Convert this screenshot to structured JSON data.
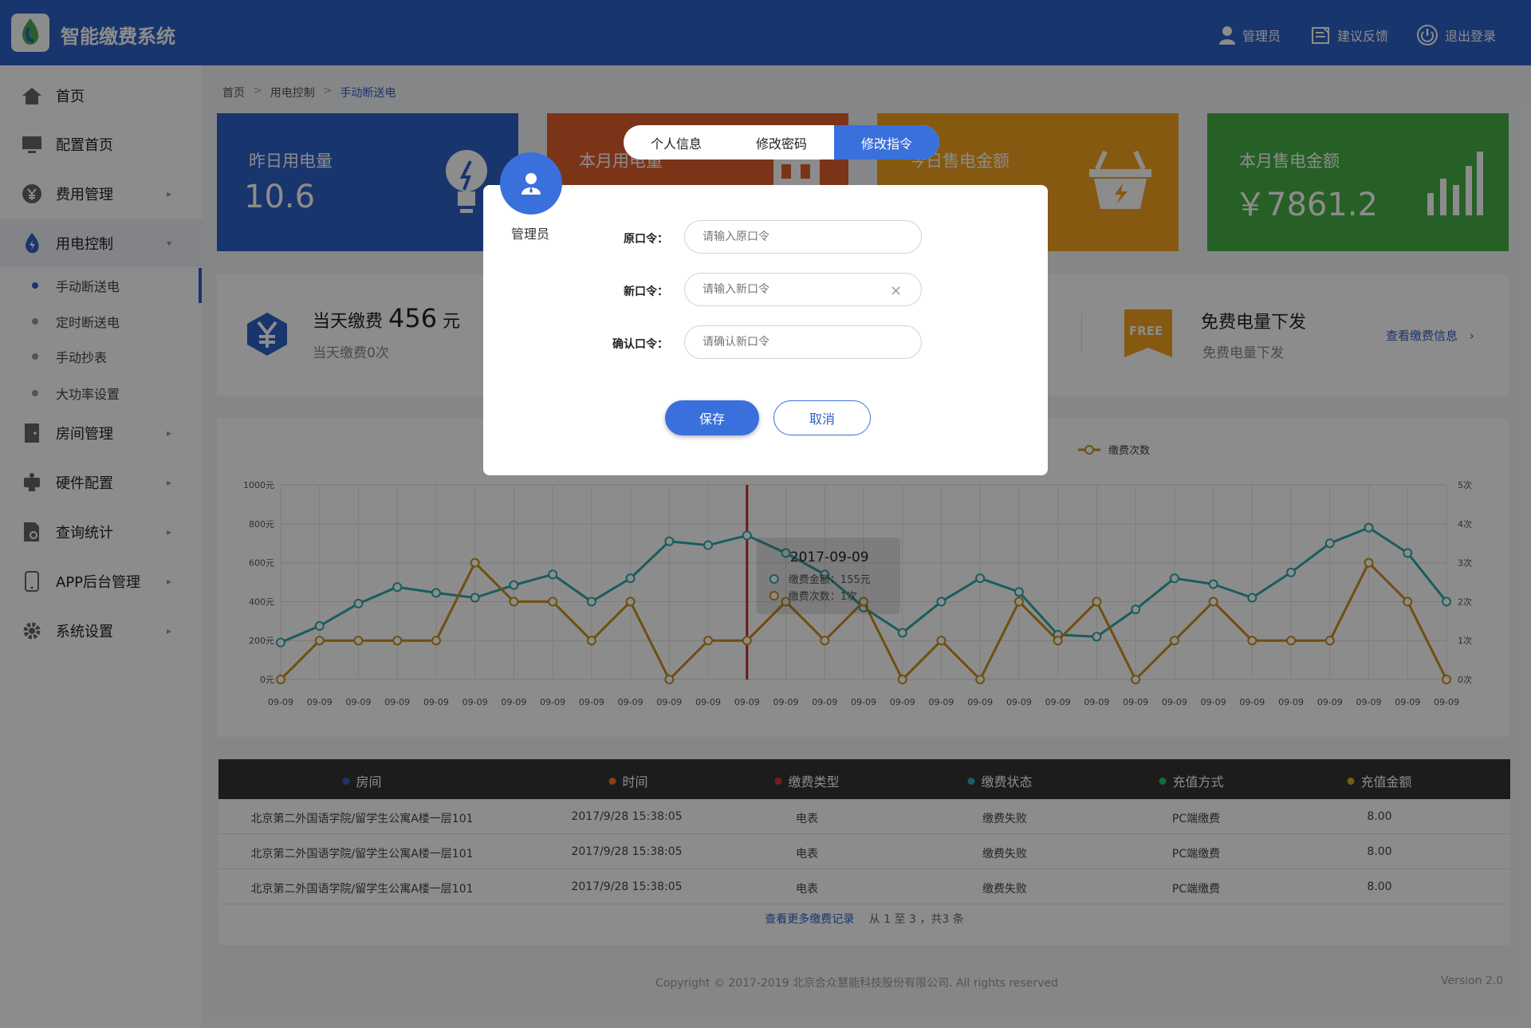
{
  "app": {
    "title": "智能缴费系统"
  },
  "topbar": {
    "admin_label": "管理员",
    "feedback_label": "建议反馈",
    "logout_label": "退出登录"
  },
  "sidebar": {
    "items": [
      {
        "label": "首页"
      },
      {
        "label": "配置首页"
      },
      {
        "label": "费用管理"
      },
      {
        "label": "用电控制"
      },
      {
        "label": "房间管理"
      },
      {
        "label": "硬件配置"
      },
      {
        "label": "查询统计"
      },
      {
        "label": "APP后台管理"
      },
      {
        "label": "系统设置"
      }
    ],
    "sub_items": [
      {
        "label": "手动断送电"
      },
      {
        "label": "定时断送电"
      },
      {
        "label": "手动抄表"
      },
      {
        "label": "大功率设置"
      }
    ]
  },
  "breadcrumb": {
    "home": "首页",
    "parent": "用电控制",
    "current": "手动断送电"
  },
  "stats": [
    {
      "label": "昨日用电量",
      "value": "10.6",
      "color": "#2f62c6"
    },
    {
      "label": "本月用电量",
      "value": "",
      "color": "#e25f2e"
    },
    {
      "label": "今日售电金额",
      "value": "",
      "color": "#f2a31d"
    },
    {
      "label": "本月售电金额",
      "value": "￥7861.2",
      "color": "#45b045"
    }
  ],
  "summary": {
    "pay_today_prefix": "当天缴费",
    "pay_today_amount": "456",
    "pay_today_unit": "元",
    "pay_today_count": "当天缴费0次",
    "free_badge": "FREE",
    "free_title": "免费电量下发",
    "free_sub": "免费电量下发",
    "view_link": "查看缴费信息"
  },
  "chart_data": {
    "type": "line",
    "x": [
      "09-09",
      "09-09",
      "09-09",
      "09-09",
      "09-09",
      "09-09",
      "09-09",
      "09-09",
      "09-09",
      "09-09",
      "09-09",
      "09-09",
      "09-09",
      "09-09",
      "09-09",
      "09-09",
      "09-09",
      "09-09",
      "09-09",
      "09-09",
      "09-09",
      "09-09",
      "09-09",
      "09-09",
      "09-09",
      "09-09",
      "09-09",
      "09-09",
      "09-09",
      "09-09",
      "09-09"
    ],
    "y_left_ticks": [
      "0元",
      "200元",
      "400元",
      "600元",
      "800元",
      "1000元"
    ],
    "y_right_ticks": [
      "0次",
      "1次",
      "2次",
      "3次",
      "4次",
      "5次"
    ],
    "ylim_left": [
      0,
      1000
    ],
    "ylim_right": [
      0,
      5
    ],
    "series": [
      {
        "name": "缴费金额",
        "axis": "left",
        "color": "#2fa9a9",
        "values": [
          190,
          275,
          390,
          475,
          445,
          420,
          485,
          540,
          400,
          520,
          710,
          690,
          740,
          650,
          540,
          370,
          240,
          400,
          520,
          450,
          230,
          220,
          360,
          520,
          490,
          420,
          550,
          700,
          780,
          650,
          400
        ]
      },
      {
        "name": "缴费次数",
        "axis": "right",
        "color": "#c9901a",
        "values": [
          0,
          1,
          1,
          1,
          1,
          3,
          2,
          2,
          1,
          2,
          0,
          1,
          1,
          2,
          1,
          2,
          0,
          1,
          0,
          2,
          1,
          2,
          0,
          1,
          2,
          1,
          1,
          1,
          3,
          2,
          0
        ]
      }
    ],
    "legend": [
      "缴费金额",
      "缴费次数"
    ],
    "highlight_index": 12,
    "tooltip": {
      "title": "2017-09-09",
      "line1": "缴费金额：155元",
      "line2": "缴费次数：1次"
    }
  },
  "table": {
    "headers": [
      {
        "label": "房间",
        "color": "#2f62c6"
      },
      {
        "label": "时间",
        "color": "#f07a2a"
      },
      {
        "label": "缴费类型",
        "color": "#d9362b"
      },
      {
        "label": "缴费状态",
        "color": "#2fa9c9"
      },
      {
        "label": "充值方式",
        "color": "#2bbf6a"
      },
      {
        "label": "充值金额",
        "color": "#c9b01a"
      }
    ],
    "rows": [
      [
        "北京第二外国语学院/留学生公寓A楼一层101",
        "2017/9/28 15:38:05",
        "电表",
        "缴费失败",
        "PC端缴费",
        "8.00"
      ],
      [
        "北京第二外国语学院/留学生公寓A楼一层101",
        "2017/9/28 15:38:05",
        "电表",
        "缴费失败",
        "PC端缴费",
        "8.00"
      ],
      [
        "北京第二外国语学院/留学生公寓A楼一层101",
        "2017/9/28 15:38:05",
        "电表",
        "缴费失败",
        "PC端缴费",
        "8.00"
      ]
    ],
    "more_link": "查看更多缴费记录",
    "pager": "从 1 至 3 ，共3 条"
  },
  "footer": {
    "copyright": "Copyright © 2017-2019 北京合众慧能科技股份有限公司. All rights reserved",
    "version": "Version 2.0"
  },
  "modal": {
    "tabs": [
      "个人信息",
      "修改密码",
      "修改指令"
    ],
    "active_tab": 2,
    "user_label": "管理员",
    "fields": [
      {
        "label": "原口令：",
        "placeholder": "请输入原口令"
      },
      {
        "label": "新口令：",
        "placeholder": "请输入新口令"
      },
      {
        "label": "确认口令：",
        "placeholder": "请确认新口令"
      }
    ],
    "save_label": "保存",
    "cancel_label": "取消"
  }
}
